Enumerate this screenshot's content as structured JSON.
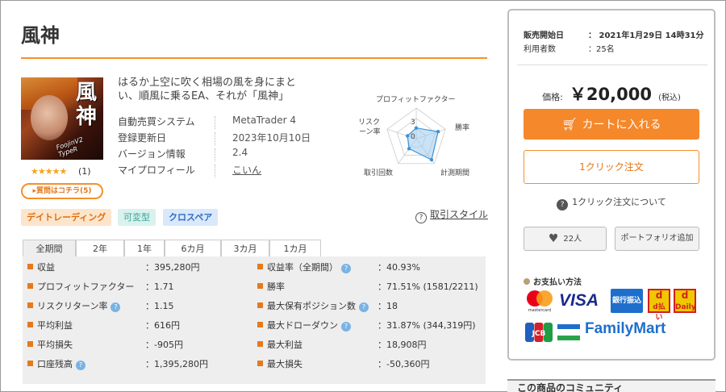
{
  "product": {
    "title": "風神",
    "image": {
      "kanji": "風神",
      "subtitle": "FoojinV2 TypeR"
    },
    "rating": {
      "stars": "★★★★★",
      "count": "(1)"
    },
    "question_button": "▸質問はコチラ(5)",
    "catchphrase": "はるか上空に吹く相場の風を身にまとい、順風に乗るEA、それが「風神」",
    "info": [
      {
        "key": "自動売買システム",
        "value": "MetaTrader 4"
      },
      {
        "key": "登録更新日",
        "value": "2023年10月10日"
      },
      {
        "key": "バージョン情報",
        "value": "2.4"
      },
      {
        "key": "マイプロフィール",
        "value": "こいん"
      }
    ],
    "tags": [
      "デイトレーディング",
      "可変型",
      "クロスペア"
    ],
    "trade_style_label": "取引スタイル"
  },
  "radar": {
    "labels": {
      "profit_factor": "プロフィットファクター",
      "win_rate": "勝率",
      "periods": "計測期間",
      "trade_count": "取引回数",
      "risk_return": "リスク\nターン率"
    },
    "scale_labels": [
      "3",
      "0"
    ],
    "values": {
      "profit_factor": 0.35,
      "win_rate": 0.75,
      "periods": 0.85,
      "trade_count": 0.4,
      "risk_return": 0.3
    },
    "colors": {
      "fill": "#9ecbee",
      "stroke": "#3d93d6",
      "grid": "#cccccc"
    }
  },
  "period_tabs": [
    "全期間",
    "2年",
    "1年",
    "6カ月",
    "3カ月",
    "1カ月"
  ],
  "stats": [
    {
      "left": {
        "label": "収益",
        "value": "：395,280円",
        "help": false
      },
      "right": {
        "label": "収益率（全期間）",
        "value": "：40.93%",
        "help": true
      }
    },
    {
      "left": {
        "label": "プロフィットファクター",
        "value": "：1.71",
        "help": false
      },
      "right": {
        "label": "勝率",
        "value": "：71.51% (1581/2211)",
        "help": false
      }
    },
    {
      "left": {
        "label": "リスクリターン率",
        "value": "：1.15",
        "help": true
      },
      "right": {
        "label": "最大保有ポジション数",
        "value": "：18",
        "help": true
      }
    },
    {
      "left": {
        "label": "平均利益",
        "value": "：616円",
        "help": false
      },
      "right": {
        "label": "最大ドローダウン",
        "value": "：31.87% (344,319円)",
        "help": true
      }
    },
    {
      "left": {
        "label": "平均損失",
        "value": "：-905円",
        "help": false
      },
      "right": {
        "label": "最大利益",
        "value": "：18,908円",
        "help": false
      }
    },
    {
      "left": {
        "label": "口座残高",
        "value": "：1,395,280円",
        "help": true
      },
      "right": {
        "label": "最大損失",
        "value": "：-50,360円",
        "help": false
      }
    }
  ],
  "sidebar": {
    "release_label": "販売開始日",
    "release_value": "：  2021年1月29日 14時31分",
    "users_label": "利用者数",
    "users_value": "：25名",
    "price_label": "価格:",
    "price_value": "￥20,000",
    "price_tax": "(税込)",
    "cart_label": "カートに入れる",
    "one_click_label": "1クリック注文",
    "about_one_click": "1クリック注文について",
    "fav_count": "22人",
    "portfolio_label": "ポートフォリオ追加",
    "payment_title": "お支払い方法",
    "payments": {
      "mastercard": "mastercard",
      "visa": "VISA",
      "bank": "銀行振込",
      "dpay": "d払い",
      "ddaily": "Daily",
      "jcb": "JCB",
      "familymart": "FamilyMart"
    },
    "community": "この商品のコミュニティ"
  },
  "colors": {
    "accent": "#f5902a",
    "cart": "#f5882a",
    "stats_bg": "#eeeeee"
  }
}
